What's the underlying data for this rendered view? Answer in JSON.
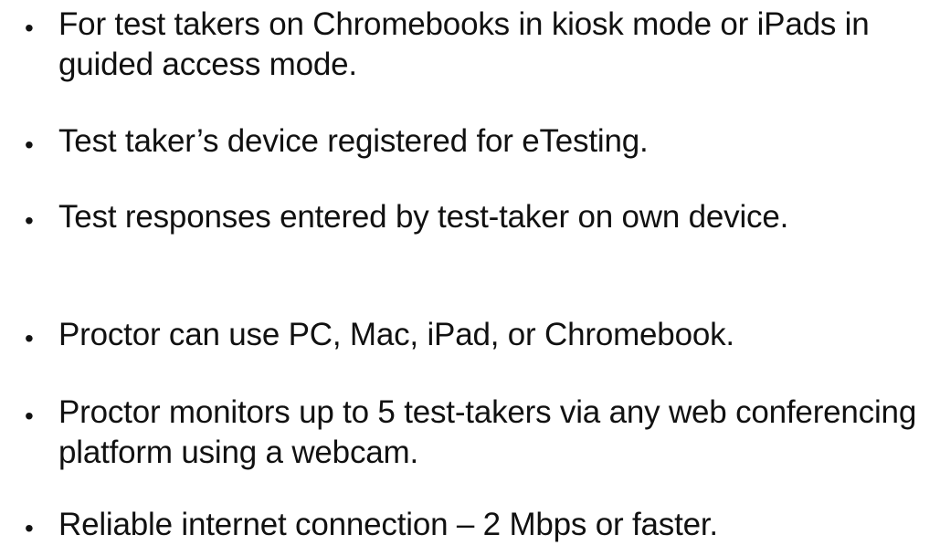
{
  "bullets": [
    "For test takers on Chromebooks in kiosk mode or iPads in guided access mode.",
    "Test taker’s device registered for eTesting.",
    "Test responses entered by test-taker on own device.",
    "Proctor can use PC, Mac, iPad, or Chromebook.",
    "Proctor monitors up to 5 test-takers via any web conferencing platform using a webcam.",
    "Reliable internet connection – 2 Mbps or faster."
  ],
  "bullet_symbol": "•"
}
